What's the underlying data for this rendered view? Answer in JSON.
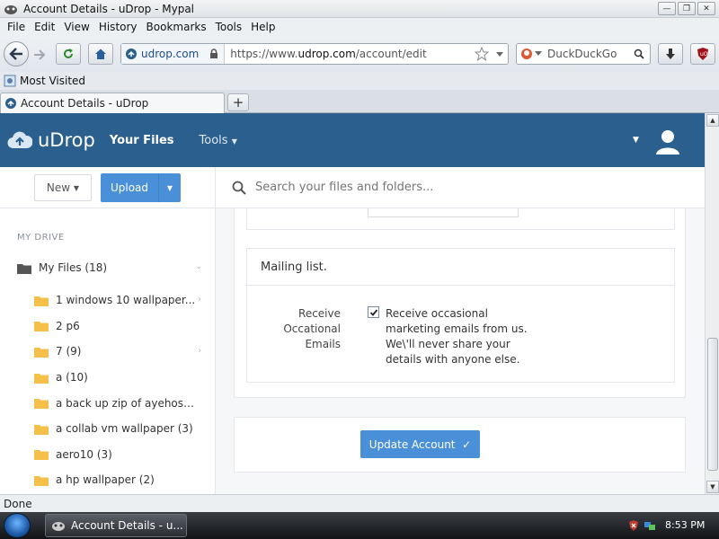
{
  "window": {
    "title": "Account Details - uDrop - Mypal"
  },
  "menu": [
    "File",
    "Edit",
    "View",
    "History",
    "Bookmarks",
    "Tools",
    "Help"
  ],
  "navbar": {
    "identity": "udrop.com",
    "url_prefix": "https://www.",
    "url_domain": "udrop.com",
    "url_path": "/account/edit",
    "search_engine": "DuckDuckGo"
  },
  "bookmarks": {
    "most_visited": "Most Visited"
  },
  "tab": {
    "title": "Account Details - uDrop",
    "new_tab": "+"
  },
  "app": {
    "brand": "uDrop",
    "nav_files": "Your Files",
    "nav_tools": "Tools",
    "new_button": "New",
    "upload_button": "Upload",
    "search_placeholder": "Search your files and folders...",
    "section_label": "MY DRIVE",
    "root_folder": "My Files (18)",
    "folders": [
      {
        "label": "1 windows 10 wallpaper...",
        "has_children": true
      },
      {
        "label": "2 p6",
        "has_children": false
      },
      {
        "label": "7 (9)",
        "has_children": true
      },
      {
        "label": "a (10)",
        "has_children": false
      },
      {
        "label": "a back up zip of ayehosti...",
        "has_children": false
      },
      {
        "label": "a collab vm wallpaper (3)",
        "has_children": false
      },
      {
        "label": "aero10 (3)",
        "has_children": false
      },
      {
        "label": "a hp wallpaper (2)",
        "has_children": false
      }
    ]
  },
  "form": {
    "mailing_heading": "Mailing list.",
    "receive_label": "Receive Occational Emails",
    "receive_checked": true,
    "receive_text": "Receive occasional marketing emails from us. We\\'ll never share your details with anyone else.",
    "update_button": "Update Account"
  },
  "status": {
    "text": "Done"
  },
  "taskbar": {
    "task_label": "Account Details - u...",
    "clock": "8:53 PM"
  },
  "colors": {
    "header_bg": "#2b5f8e",
    "primary_button": "#4a90d9"
  }
}
